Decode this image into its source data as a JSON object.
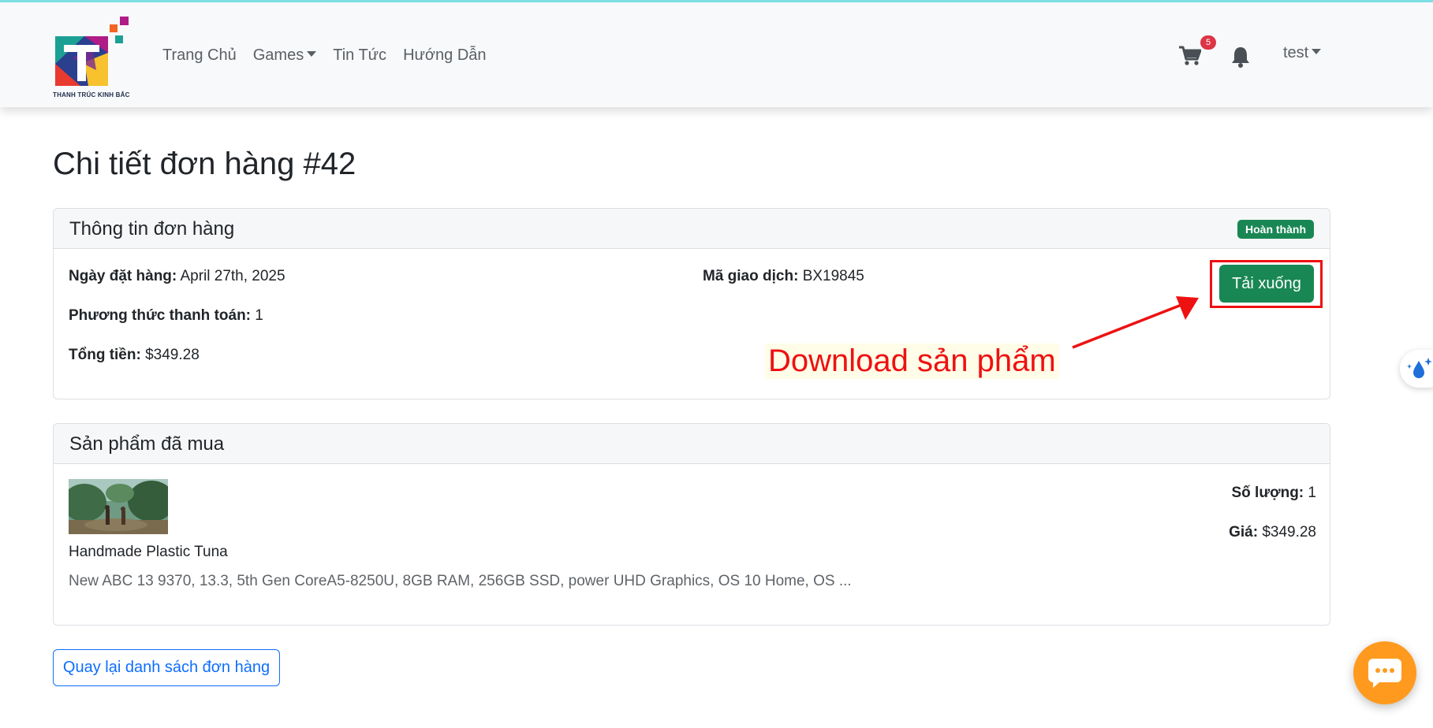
{
  "header": {
    "logo_caption": "THANH TRÚC KINH BẮC",
    "nav": [
      {
        "label": "Trang Chủ",
        "dropdown": false
      },
      {
        "label": "Games",
        "dropdown": true
      },
      {
        "label": "Tin Tức",
        "dropdown": false
      },
      {
        "label": "Hướng Dẫn",
        "dropdown": false
      }
    ],
    "cart_count": "5",
    "user_label": "test",
    "icons": [
      "cart-icon",
      "bell-icon",
      "caret-down-icon"
    ]
  },
  "page_title": "Chi tiết đơn hàng #42",
  "order_info": {
    "title": "Thông tin đơn hàng",
    "status": "Hoàn thành",
    "order_date_label": "Ngày đặt hàng:",
    "order_date": "April 27th, 2025",
    "transaction_label": "Mã giao dịch:",
    "transaction_id": "BX19845",
    "payment_label": "Phương thức thanh toán:",
    "payment_method": "1",
    "total_label": "Tổng tiền:",
    "total": "$349.28",
    "download_label": "Tải xuống",
    "annotation": "Download sản phẩm"
  },
  "purchased": {
    "title": "Sản phẩm đã mua",
    "items": [
      {
        "name": "Handmade Plastic Tuna",
        "description": "New ABC 13 9370, 13.3, 5th Gen CoreA5-8250U, 8GB RAM, 256GB SSD, power UHD Graphics, OS 10 Home, OS ...",
        "quantity_label": "Số lượng:",
        "quantity": "1",
        "price_label": "Giá:",
        "price": "$349.28"
      }
    ]
  },
  "back_label": "Quay lại danh sách đơn hàng",
  "colors": {
    "success": "#198754",
    "primary": "#0d6efd",
    "annotation": "#ee1111",
    "chat": "#ff9a1e",
    "badge": "#dc3545"
  }
}
